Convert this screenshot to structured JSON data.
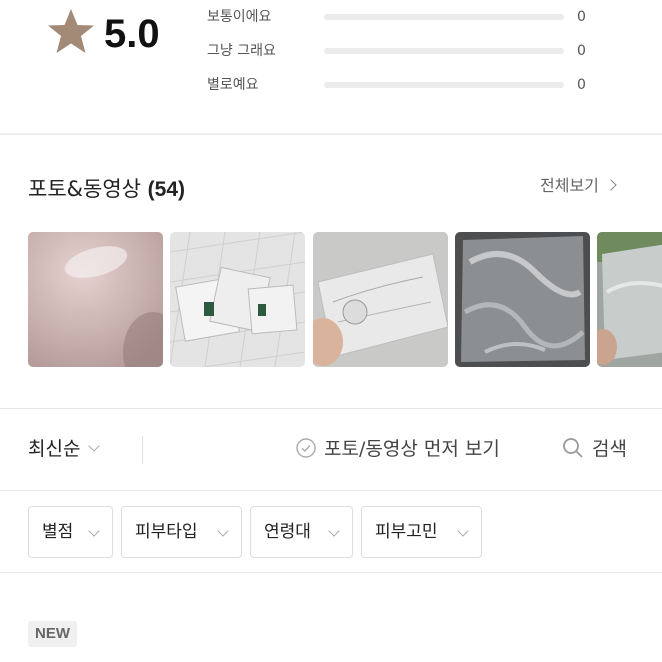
{
  "rating": {
    "score": "5.0",
    "star_icon": "star-icon",
    "star_color": "#a38a77",
    "distribution": [
      {
        "label": "보통이에요",
        "count": "0",
        "fraction": 0
      },
      {
        "label": "그냥 그래요",
        "count": "0",
        "fraction": 0
      },
      {
        "label": "별로예요",
        "count": "0",
        "fraction": 0
      }
    ]
  },
  "photos": {
    "title": "포토&동영상",
    "count": "(54)",
    "view_all": "전체보기",
    "thumbnails": [
      "photo-1",
      "photo-2",
      "photo-3",
      "photo-4",
      "photo-5"
    ]
  },
  "sort_bar": {
    "sort_label": "최신순",
    "photo_first_label": "포토/동영상 먼저 보기",
    "search_label": "검색"
  },
  "filters": [
    "별점",
    "피부타입",
    "연령대",
    "피부고민"
  ],
  "review": {
    "badge": "NEW"
  }
}
